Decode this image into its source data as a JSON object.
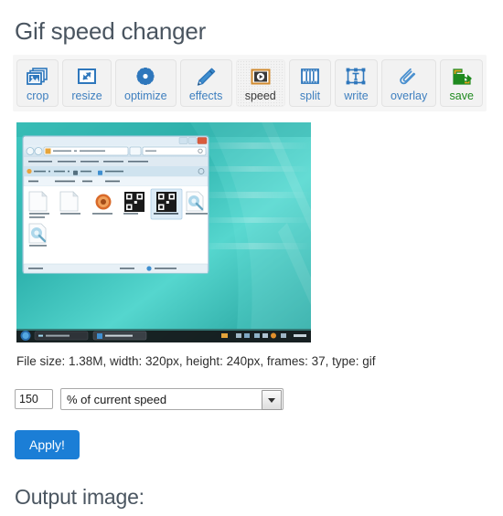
{
  "page": {
    "title": "Gif speed changer",
    "output_heading": "Output image:"
  },
  "toolbar": {
    "buttons": [
      {
        "label": "crop",
        "icon": "crop-images-icon",
        "state": "normal",
        "color": "#3e7fbf"
      },
      {
        "label": "resize",
        "icon": "resize-arrow-icon",
        "state": "normal",
        "color": "#3e7fbf"
      },
      {
        "label": "optimize",
        "icon": "gear-star-icon",
        "state": "normal",
        "color": "#3e7fbf"
      },
      {
        "label": "effects",
        "icon": "pencil-icon",
        "state": "normal",
        "color": "#3e7fbf"
      },
      {
        "label": "speed",
        "icon": "play-screen-icon",
        "state": "active",
        "color": "#3a3a3a"
      },
      {
        "label": "split",
        "icon": "film-strip-icon",
        "state": "normal",
        "color": "#3e7fbf"
      },
      {
        "label": "write",
        "icon": "text-frame-icon",
        "state": "normal",
        "color": "#3e7fbf"
      },
      {
        "label": "overlay",
        "icon": "paperclip-icon",
        "state": "normal",
        "color": "#3e7fbf"
      },
      {
        "label": "save",
        "icon": "share-export-icon",
        "state": "normal",
        "color": "#1f8a1f"
      }
    ]
  },
  "preview": {
    "alt": "animated gif preview of a Windows Explorer window on a teal desktop",
    "file_info": "File size: 1.38M, width: 320px, height: 240px, frames: 37, type: gif",
    "inner_screenshot": {
      "address_bar": "Program Files  ▸  VGDesktop",
      "search_placeholder": "検索",
      "menu_items": [
        "ファイル(F)",
        "編集(E)",
        "表示(V)",
        "ツール(T)",
        "ヘルプ(H)"
      ],
      "toolbar_items": [
        "整理",
        "共有",
        "書き込む",
        "新しいフォルダー"
      ],
      "column_headers": [
        "名前",
        "更新日時",
        "種類",
        "サイズ"
      ],
      "files": [
        "GNU Public License.txt",
        "ReadMe.txt",
        "uninst.exe",
        "VD.exe",
        "VDConfig.exe",
        "VDHooker.dll",
        "VDPage.dll"
      ],
      "status_left": "7 個の項目",
      "status_size": "20.5 KB",
      "status_right": "コンピューター",
      "taskbar_window": "VGDesktop"
    }
  },
  "controls": {
    "amount_value": "150",
    "amount_placeholder": "",
    "unit_selected": "% of current speed",
    "unit_options": [
      "% of current speed"
    ],
    "apply_label": "Apply!"
  },
  "colors": {
    "title": "#4a5560",
    "link_blue": "#3e7fbf",
    "save_green": "#1f8a1f",
    "apply_blue": "#1b7ed6",
    "toolbar_bg": "#f6f6f6"
  }
}
